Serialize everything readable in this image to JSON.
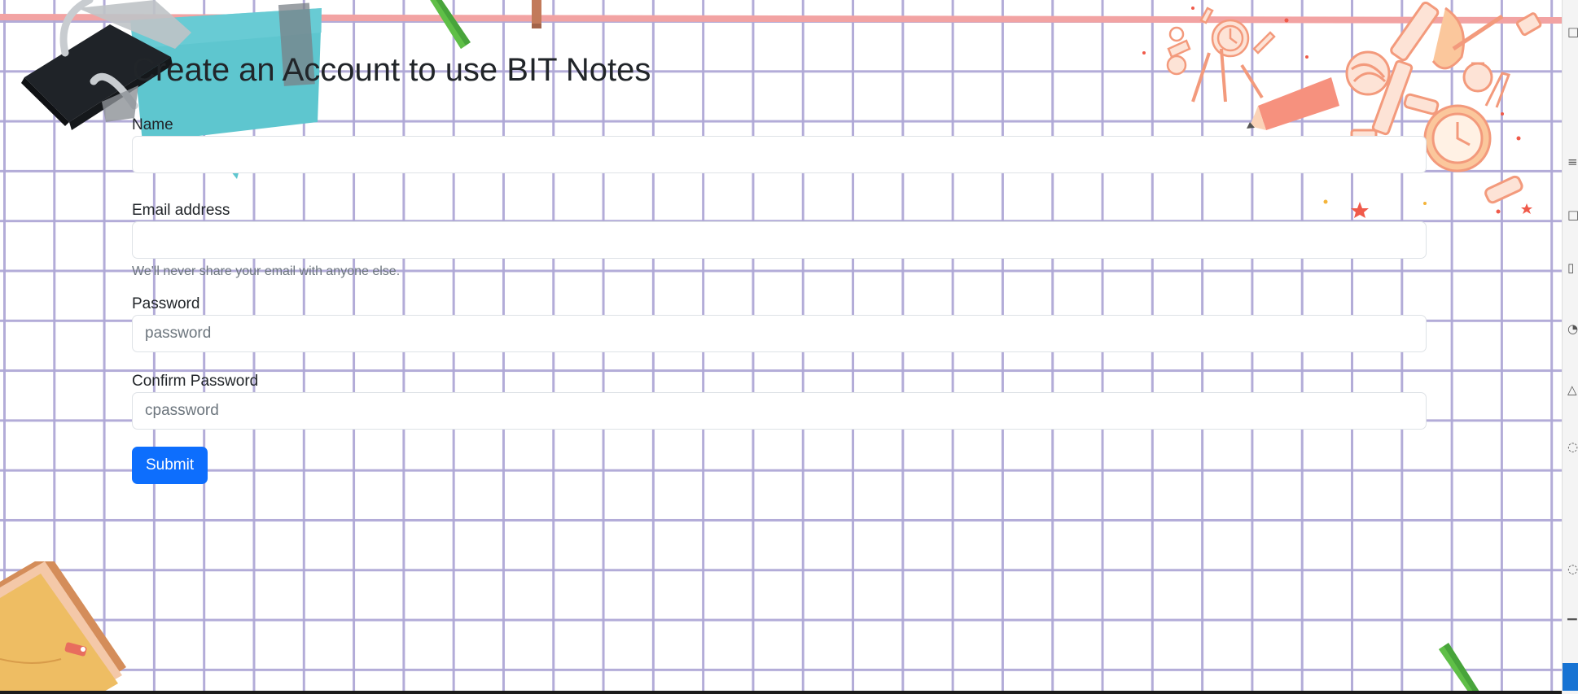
{
  "form": {
    "title": "Create an Account to use BIT Notes",
    "name": {
      "label": "Name",
      "value": "",
      "placeholder": ""
    },
    "email": {
      "label": "Email address",
      "value": "",
      "placeholder": "",
      "help": "We'll never share your email with anyone else."
    },
    "password": {
      "label": "Password",
      "value": "",
      "placeholder": "password"
    },
    "cpassword": {
      "label": "Confirm Password",
      "value": "",
      "placeholder": "cpassword"
    },
    "submit_label": "Submit"
  },
  "icons": {
    "binder_clip": "binder-clip-icon",
    "sticky_note": "sticky-note-icon",
    "pencil": "pencil-icon",
    "stationery_doodles": "stationery-doodles-icon",
    "notebook": "notebook-icon"
  },
  "colors": {
    "accent": "#0d6efd",
    "grid_line": "#afa8d6",
    "top_rule": "#f2a3a3",
    "sticky_note": "#5ec6cf",
    "binder_clip": "#2b2f34",
    "doodle": "#f39a7c",
    "notebook": "#eebd63"
  }
}
